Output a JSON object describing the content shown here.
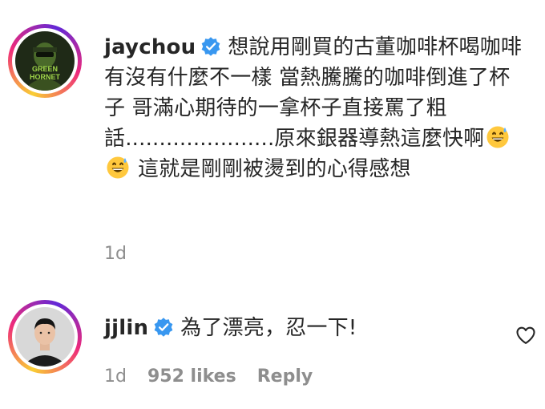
{
  "comments": [
    {
      "username": "jaychou",
      "verified": true,
      "text_parts": [
        "想說用剛買的古董咖啡杯喝咖啡有沒有什麼不一樣 當熱騰騰的咖啡倒進了杯子 哥滿心期待的一拿杯子直接罵了粗話......................原來銀器導熱這麼快啊",
        "這就是剛剛被燙到的心得感想"
      ],
      "emoji": [
        "grinning-sweat-emoji",
        "grinning-sweat-emoji"
      ],
      "avatar": {
        "icon": "green-hornet-avatar",
        "text": "GREEN HORNET"
      },
      "time": "1d"
    },
    {
      "username": "jjlin",
      "verified": true,
      "text": "為了漂亮，忍一下!",
      "avatar": {
        "icon": "person-avatar"
      },
      "time": "1d",
      "likes": "952 likes",
      "reply": "Reply",
      "like_icon": "heart-outline-icon"
    }
  ],
  "colors": {
    "verified_blue": "#3897f0",
    "meta_gray": "#8e8e8e",
    "text": "#262626"
  }
}
